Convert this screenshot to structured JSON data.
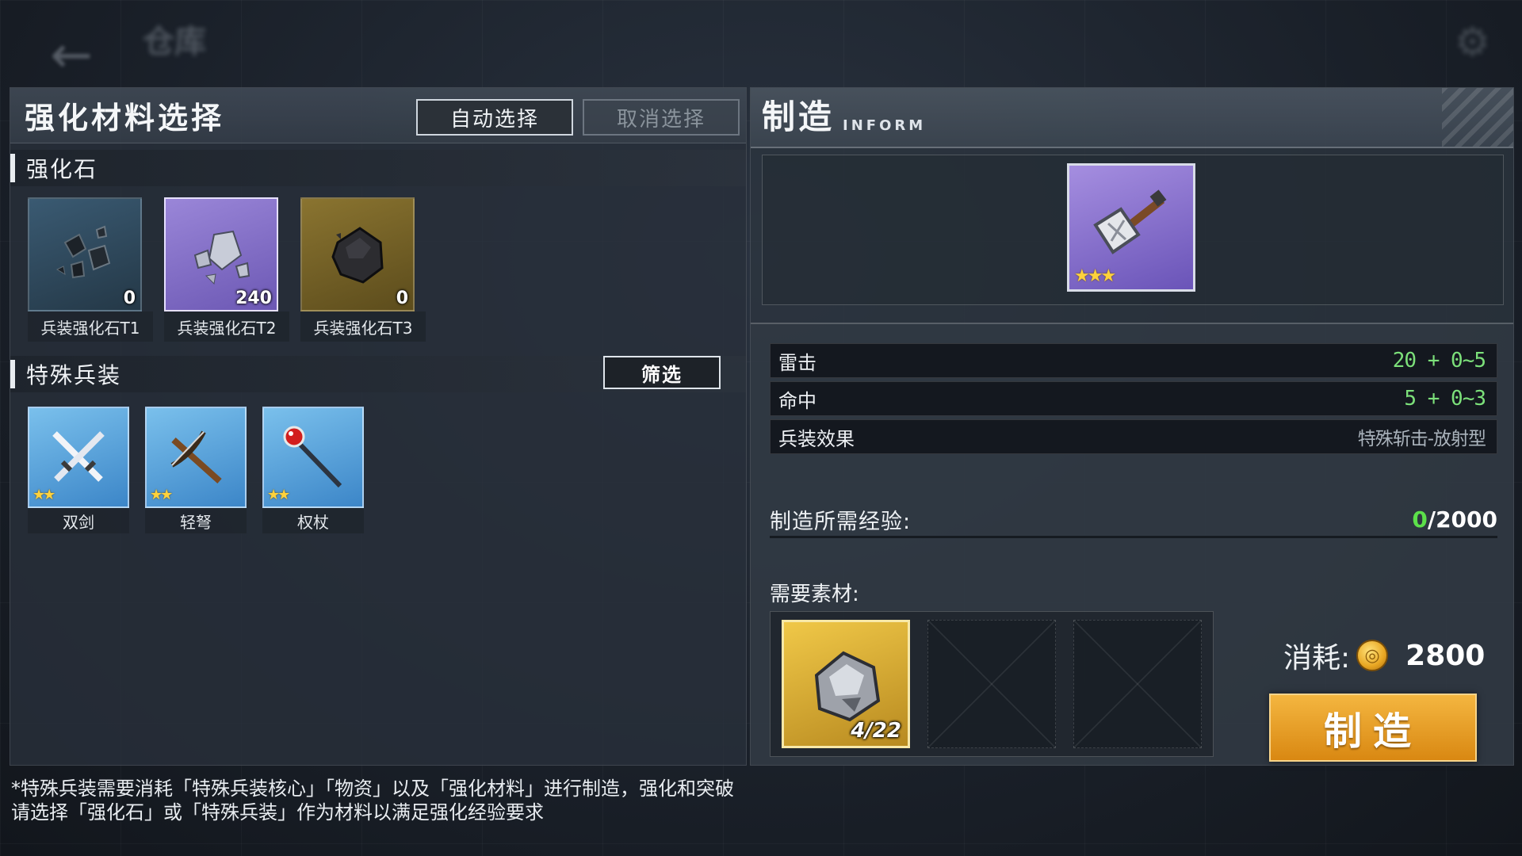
{
  "topbar": {
    "title": "仓库"
  },
  "left": {
    "title": "强化材料选择",
    "auto_select": "自动选择",
    "cancel_select": "取消选择",
    "stones_section": "强化石",
    "stones": [
      {
        "name": "兵装强化石T1",
        "count": "0"
      },
      {
        "name": "兵装强化石T2",
        "count": "240"
      },
      {
        "name": "兵装强化石T3",
        "count": "0"
      }
    ],
    "weapons_section": "特殊兵装",
    "filter": "筛选",
    "weapons": [
      {
        "name": "双剑",
        "stars": "★★"
      },
      {
        "name": "轻弩",
        "stars": "★★"
      },
      {
        "name": "权杖",
        "stars": "★★"
      }
    ]
  },
  "right": {
    "title": "制造",
    "subtitle": "INFORM",
    "preview_stars": "★★★",
    "stats": [
      {
        "label": "雷击",
        "value": "20 + 0~5"
      },
      {
        "label": "命中",
        "value": "5 + 0~3"
      },
      {
        "label": "兵装效果",
        "value": "特殊斩击-放射型"
      }
    ],
    "exp_label": "制造所需经验:",
    "exp_current": "0",
    "exp_total": "/2000",
    "materials_label": "需要素材:",
    "material_count": "4/22",
    "cost_label": "消耗:",
    "cost_value": "2800",
    "make_button": "制造"
  },
  "notes": {
    "line1": "*特殊兵装需要消耗「特殊兵装核心」「物资」以及「强化材料」进行制造，强化和突破",
    "line2": "请选择「强化石」或「特殊兵装」作为材料以满足强化经验要求"
  },
  "colors": {
    "accent_green": "#7ce07a",
    "make_orange": "#e89a1e",
    "rare_purple": "#8a72d0",
    "weapon_blue": "#5aa6e0"
  }
}
